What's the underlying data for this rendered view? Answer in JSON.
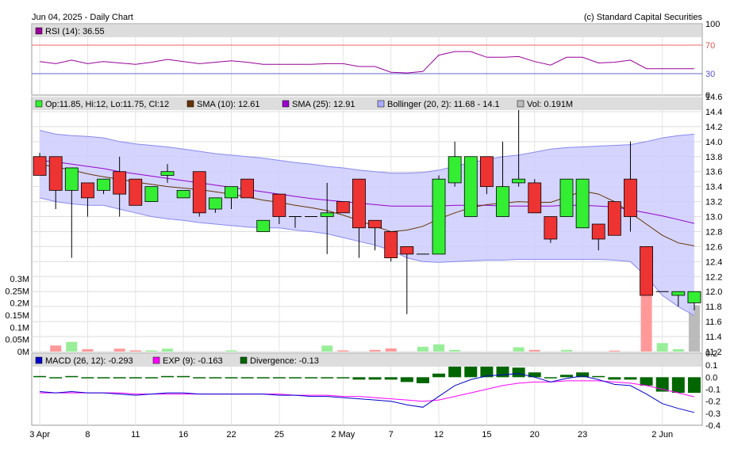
{
  "header": {
    "title": "Jun 04, 2025 - Daily Chart",
    "copyright": "(c) Standard Capital Securities"
  },
  "colors": {
    "up": "#33ee33",
    "down": "#ee3333",
    "rsi": "#990099",
    "sma10": "#663300",
    "sma25": "#9900cc",
    "bollinger_fill": "#ccccff",
    "bollinger_line": "#8888ee",
    "macd": "#0000cc",
    "exp": "#ff00ff",
    "divergence": "#006600",
    "volume_up": "#99ee99",
    "volume_down": "#ff9999",
    "volume_last": "#bbbbbb"
  },
  "chart_data": [
    {
      "type": "line",
      "title": "",
      "legend": [
        {
          "name": "RSI (14): 36.55",
          "color": "#990099"
        }
      ],
      "ylim": [
        0,
        100
      ],
      "y_ticks": [
        "100",
        "70",
        "30",
        "0"
      ],
      "reference_lines": [
        70,
        30
      ],
      "series": [
        {
          "name": "RSI (14)",
          "values": [
            47,
            44,
            49,
            44,
            47,
            45,
            43,
            46,
            50,
            47,
            44,
            46,
            48,
            46,
            43,
            43,
            43,
            43,
            44,
            44,
            40,
            40,
            32,
            31,
            33,
            56,
            61,
            61,
            53,
            53,
            54,
            47,
            42,
            53,
            53,
            45,
            46,
            49,
            37,
            37,
            37,
            37
          ]
        }
      ]
    },
    {
      "type": "candlestick",
      "legend": [
        {
          "name": "Op:11.85, Hi:12, Lo:11.75, Cl:12",
          "color": "#33ee33"
        },
        {
          "name": "SMA (10): 12.61",
          "color": "#663300"
        },
        {
          "name": "SMA (25): 12.91",
          "color": "#9900cc"
        },
        {
          "name": "Bollinger (20, 2): 11.68 - 14.1",
          "color": "#aaaaff"
        },
        {
          "name": "Vol: 0.191M",
          "color": "#bbbbbb"
        }
      ],
      "ylim": [
        11.2,
        14.6
      ],
      "y_ticks": [
        "14.6",
        "14.4",
        "14.2",
        "14.0",
        "13.8",
        "13.6",
        "13.4",
        "13.2",
        "13.0",
        "12.8",
        "12.6",
        "12.4",
        "12.2",
        "12.0",
        "11.8",
        "11.6",
        "11.4",
        "11.2"
      ],
      "ohlc": [
        [
          13.8,
          13.85,
          13.55,
          13.55
        ],
        [
          13.8,
          13.8,
          13.1,
          13.35
        ],
        [
          13.35,
          13.65,
          12.45,
          13.65
        ],
        [
          13.45,
          13.45,
          13.0,
          13.25
        ],
        [
          13.35,
          13.5,
          13.3,
          13.5
        ],
        [
          13.6,
          13.8,
          13.0,
          13.3
        ],
        [
          13.5,
          13.5,
          13.15,
          13.15
        ],
        [
          13.2,
          13.35,
          13.2,
          13.4
        ],
        [
          13.55,
          13.7,
          13.45,
          13.6
        ],
        [
          13.25,
          13.3,
          13.25,
          13.35
        ],
        [
          13.6,
          13.6,
          13.0,
          13.05
        ],
        [
          13.1,
          13.25,
          13.05,
          13.25
        ],
        [
          13.25,
          13.35,
          13.1,
          13.4
        ],
        [
          13.5,
          13.5,
          13.25,
          13.25
        ],
        [
          12.8,
          12.95,
          12.8,
          12.95
        ],
        [
          13.3,
          13.3,
          12.9,
          13.0
        ],
        [
          13.0,
          13.0,
          12.85,
          13.0
        ],
        [
          13.0,
          13.0,
          13.0,
          13.0
        ],
        [
          13.0,
          13.45,
          12.5,
          13.05
        ],
        [
          13.2,
          13.2,
          13.05,
          13.05
        ],
        [
          13.5,
          13.5,
          12.45,
          12.85
        ],
        [
          12.95,
          12.95,
          12.55,
          12.85
        ],
        [
          12.8,
          12.8,
          12.4,
          12.45
        ],
        [
          12.6,
          12.6,
          11.7,
          12.5
        ],
        [
          12.5,
          12.5,
          12.5,
          12.5
        ],
        [
          12.5,
          13.55,
          12.5,
          13.5
        ],
        [
          13.45,
          14.0,
          13.4,
          13.8
        ],
        [
          13.0,
          13.8,
          13.0,
          13.8
        ],
        [
          13.8,
          13.8,
          13.3,
          13.4
        ],
        [
          13.0,
          14.0,
          13.0,
          13.4
        ],
        [
          13.45,
          14.5,
          13.4,
          13.5
        ],
        [
          13.45,
          13.5,
          13.05,
          13.05
        ],
        [
          13.0,
          13.0,
          12.65,
          12.7
        ],
        [
          13.0,
          13.5,
          13.0,
          13.5
        ],
        [
          12.85,
          13.5,
          12.85,
          13.5
        ],
        [
          12.9,
          12.9,
          12.55,
          12.7
        ],
        [
          13.2,
          13.2,
          12.75,
          12.75
        ],
        [
          13.5,
          14.0,
          12.8,
          13.0
        ],
        [
          12.6,
          12.6,
          11.95,
          11.95
        ],
        [
          12.0,
          12.0,
          12.0,
          12.0
        ],
        [
          11.95,
          12.0,
          11.8,
          12.0
        ],
        [
          11.85,
          12.0,
          11.75,
          12.0
        ]
      ],
      "sma10": [
        13.7,
        13.66,
        13.62,
        13.57,
        13.53,
        13.5,
        13.46,
        13.43,
        13.4,
        13.38,
        13.36,
        13.33,
        13.3,
        13.26,
        13.22,
        13.19,
        13.15,
        13.12,
        13.08,
        13.02,
        12.95,
        12.87,
        12.8,
        12.82,
        12.87,
        12.97,
        13.05,
        13.12,
        13.16,
        13.18,
        13.2,
        13.19,
        13.19,
        13.26,
        13.34,
        13.3,
        13.2,
        13.05,
        12.9,
        12.75,
        12.65,
        12.61
      ],
      "sma25": [
        13.75,
        13.73,
        13.7,
        13.67,
        13.64,
        13.6,
        13.57,
        13.54,
        13.51,
        13.48,
        13.45,
        13.42,
        13.39,
        13.36,
        13.33,
        13.3,
        13.27,
        13.24,
        13.22,
        13.2,
        13.18,
        13.16,
        13.14,
        13.14,
        13.14,
        13.14,
        13.15,
        13.15,
        13.15,
        13.14,
        13.14,
        13.14,
        13.14,
        13.15,
        13.15,
        13.14,
        13.13,
        13.09,
        13.05,
        13.01,
        12.96,
        12.91
      ],
      "bb_upper": [
        14.15,
        14.1,
        14.08,
        14.07,
        14.05,
        14.0,
        13.97,
        13.95,
        13.93,
        13.9,
        13.87,
        13.84,
        13.82,
        13.8,
        13.78,
        13.75,
        13.72,
        13.7,
        13.67,
        13.65,
        13.62,
        13.6,
        13.58,
        13.58,
        13.59,
        13.62,
        13.67,
        13.72,
        13.76,
        13.8,
        13.82,
        13.86,
        13.9,
        13.92,
        13.93,
        13.94,
        13.95,
        13.96,
        14.0,
        14.05,
        14.08,
        14.1
      ],
      "bb_lower": [
        13.25,
        13.2,
        13.17,
        13.15,
        13.15,
        13.1,
        13.05,
        13.0,
        12.97,
        12.95,
        12.92,
        12.9,
        12.88,
        12.86,
        12.85,
        12.85,
        12.82,
        12.8,
        12.77,
        12.72,
        12.67,
        12.62,
        12.55,
        12.45,
        12.4,
        12.39,
        12.4,
        12.41,
        12.42,
        12.42,
        12.43,
        12.43,
        12.43,
        12.43,
        12.43,
        12.43,
        12.42,
        12.4,
        12.2,
        11.95,
        11.8,
        11.68
      ],
      "volume": {
        "ylim": [
          0,
          0.3
        ],
        "y_ticks": [
          "0.3M",
          "0.25M",
          "0.2M",
          "0.15M",
          "0.1M",
          "0.05M",
          "0M"
        ],
        "values": [
          0.0,
          0.025,
          0.04,
          0.01,
          0.0,
          0.012,
          0.005,
          0.005,
          0.012,
          0.0,
          0.0,
          0.0,
          0.005,
          0.0,
          0.0,
          0.0,
          0.0,
          0.0,
          0.025,
          0.005,
          0.0,
          0.007,
          0.013,
          0.0,
          0.02,
          0.03,
          0.007,
          0.0,
          0.0,
          0.0,
          0.018,
          0.007,
          0.0,
          0.007,
          0.0,
          0.0,
          0.004,
          0.0,
          0.24,
          0.035,
          0.01,
          0.191
        ]
      }
    },
    {
      "type": "bar",
      "legend": [
        {
          "name": "MACD (26, 12): -0.293",
          "color": "#0000cc"
        },
        {
          "name": "EXP (9): -0.163",
          "color": "#ff00ff"
        },
        {
          "name": "Divergence: -0.13",
          "color": "#006600"
        }
      ],
      "ylim": [
        -0.4,
        0.2
      ],
      "y_ticks": [
        "0.2",
        "0.1",
        "0.0",
        "-0.1",
        "-0.2",
        "-0.3",
        "-0.4"
      ],
      "macd": [
        -0.12,
        -0.13,
        -0.12,
        -0.13,
        -0.13,
        -0.14,
        -0.15,
        -0.14,
        -0.13,
        -0.13,
        -0.14,
        -0.14,
        -0.14,
        -0.14,
        -0.14,
        -0.15,
        -0.15,
        -0.16,
        -0.16,
        -0.17,
        -0.18,
        -0.19,
        -0.2,
        -0.23,
        -0.25,
        -0.16,
        -0.07,
        -0.02,
        0.01,
        0.02,
        0.03,
        0.0,
        -0.04,
        -0.01,
        0.01,
        -0.02,
        -0.06,
        -0.07,
        -0.14,
        -0.22,
        -0.26,
        -0.293
      ],
      "exp": [
        -0.13,
        -0.13,
        -0.13,
        -0.13,
        -0.13,
        -0.13,
        -0.14,
        -0.14,
        -0.14,
        -0.14,
        -0.14,
        -0.14,
        -0.14,
        -0.14,
        -0.14,
        -0.14,
        -0.15,
        -0.15,
        -0.15,
        -0.16,
        -0.16,
        -0.17,
        -0.18,
        -0.19,
        -0.2,
        -0.19,
        -0.16,
        -0.13,
        -0.1,
        -0.07,
        -0.05,
        -0.04,
        -0.04,
        -0.03,
        -0.03,
        -0.03,
        -0.04,
        -0.05,
        -0.07,
        -0.1,
        -0.13,
        -0.163
      ],
      "divergence": [
        0.01,
        0.0,
        0.01,
        0.0,
        0.0,
        -0.01,
        -0.01,
        0.0,
        0.01,
        0.01,
        0.0,
        0.0,
        0.0,
        0.0,
        0.0,
        -0.01,
        0.0,
        -0.01,
        -0.01,
        -0.01,
        -0.02,
        -0.02,
        -0.02,
        -0.04,
        -0.05,
        0.03,
        0.09,
        0.11,
        0.11,
        0.09,
        0.08,
        0.04,
        0.0,
        0.02,
        0.04,
        0.01,
        -0.02,
        -0.02,
        -0.07,
        -0.12,
        -0.13,
        -0.13
      ]
    }
  ],
  "x_axis": {
    "tick_labels": [
      {
        "index": 0,
        "label": "3 Apr"
      },
      {
        "index": 3,
        "label": "8"
      },
      {
        "index": 6,
        "label": "11"
      },
      {
        "index": 9,
        "label": "16"
      },
      {
        "index": 12,
        "label": "22"
      },
      {
        "index": 15,
        "label": "25"
      },
      {
        "index": 19,
        "label": "2 May"
      },
      {
        "index": 22,
        "label": "7"
      },
      {
        "index": 25,
        "label": "12"
      },
      {
        "index": 28,
        "label": "15"
      },
      {
        "index": 31,
        "label": "20"
      },
      {
        "index": 34,
        "label": "23"
      },
      {
        "index": 39,
        "label": "2 Jun"
      }
    ]
  }
}
